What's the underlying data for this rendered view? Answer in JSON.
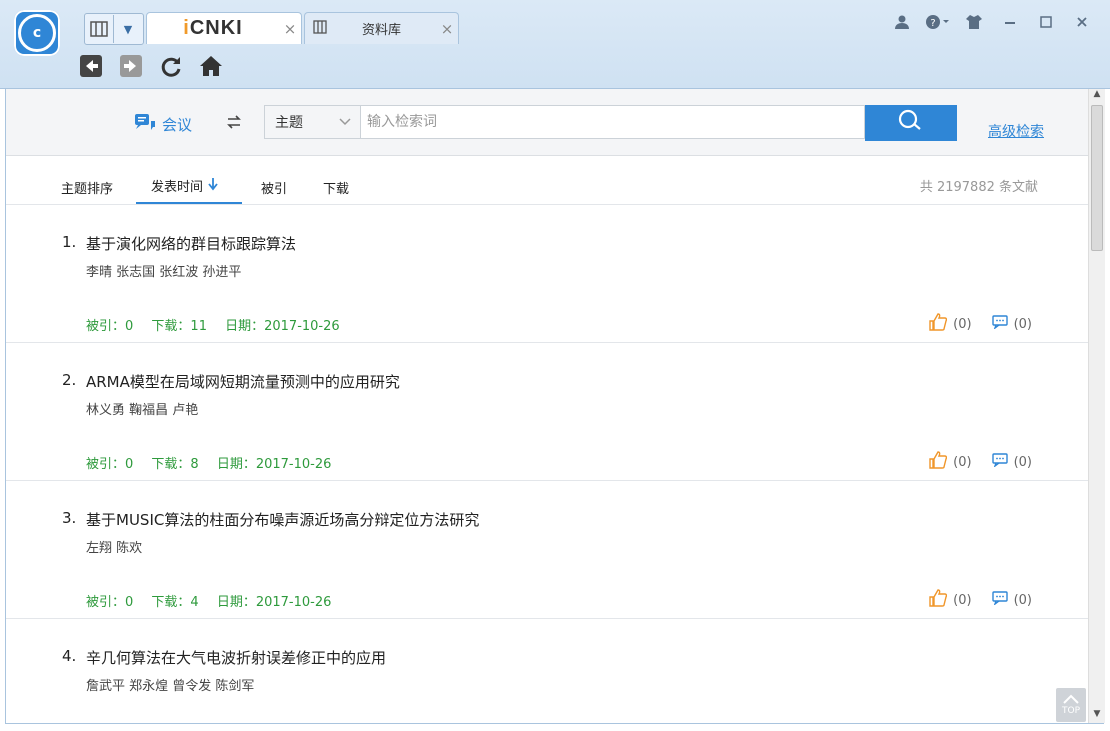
{
  "titlebar": {
    "app_logo_text": "c",
    "tabs": [
      {
        "label": "CNKI",
        "icon": "cnki-logo",
        "close": "×",
        "active": true
      },
      {
        "label": "资料库",
        "icon": "library-icon",
        "close": "×",
        "active": false
      }
    ],
    "window_controls": [
      "user-icon",
      "help-icon",
      "skin-icon",
      "minimize-icon",
      "maximize-icon",
      "close-icon"
    ]
  },
  "navigation": {
    "back": "◀",
    "forward": "▶",
    "refresh": "⟳",
    "home": "⌂"
  },
  "search": {
    "database_label": "会议",
    "field_selected": "主题",
    "placeholder": "输入检索词",
    "advanced_link": "高级检索"
  },
  "sort": {
    "items": [
      "主题排序",
      "发表时间",
      "被引",
      "下载"
    ],
    "active_index": 1,
    "total_text": "共 2197882 条文献"
  },
  "results": [
    {
      "index": "1.",
      "title": "基于演化网络的群目标跟踪算法",
      "authors": "李晴 张志国 张红波 孙进平",
      "cited": "被引：0",
      "downloads": "下载：11",
      "date": "日期：2017-10-26",
      "likes": "(0)",
      "comments": "(0)"
    },
    {
      "index": "2.",
      "title": "ARMA模型在局域网短期流量预测中的应用研究",
      "authors": "林义勇 鞠福昌 卢艳",
      "cited": "被引：0",
      "downloads": "下载：8",
      "date": "日期：2017-10-26",
      "likes": "(0)",
      "comments": "(0)"
    },
    {
      "index": "3.",
      "title": "基于MUSIC算法的柱面分布噪声源近场高分辩定位方法研究",
      "authors": "左翔 陈欢",
      "cited": "被引：0",
      "downloads": "下载：4",
      "date": "日期：2017-10-26",
      "likes": "(0)",
      "comments": "(0)"
    },
    {
      "index": "4.",
      "title": "辛几何算法在大气电波折射误差修正中的应用",
      "authors": "詹武平 郑永煌 曾令发 陈剑军",
      "cited": "",
      "downloads": "",
      "date": "",
      "likes": "",
      "comments": ""
    }
  ],
  "back_to_top": "TOP",
  "colors": {
    "accent": "#2f86d6",
    "meta_green": "#2e9a3c",
    "like_orange": "#f0962a"
  }
}
